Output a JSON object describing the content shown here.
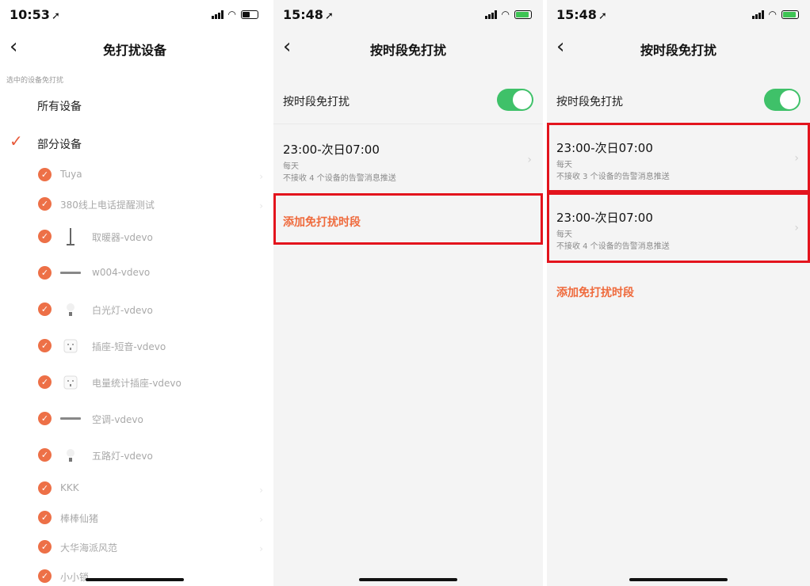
{
  "screen1": {
    "status_time": "10:53",
    "title": "免打扰设备",
    "section_hint": "选中的设备免打扰",
    "option_all": "所有设备",
    "option_partial": "部分设备",
    "devices": [
      {
        "name": "Tuya",
        "thumb": ""
      },
      {
        "name": "380线上电话提醒测试",
        "thumb": ""
      },
      {
        "name": "取暖器-vdevo",
        "thumb": "heater-icon"
      },
      {
        "name": "w004-vdevo",
        "thumb": "bar-icon"
      },
      {
        "name": "白光灯-vdevo",
        "thumb": "bulb-icon"
      },
      {
        "name": "插座-短音-vdevo",
        "thumb": "socket-icon"
      },
      {
        "name": "电量统计插座-vdevo",
        "thumb": "socket-icon"
      },
      {
        "name": "空调-vdevo",
        "thumb": "bar-icon"
      },
      {
        "name": "五路灯-vdevo",
        "thumb": "bulb-icon"
      },
      {
        "name": "KKK",
        "thumb": ""
      },
      {
        "name": "棒棒仙猪",
        "thumb": ""
      },
      {
        "name": "大华海派风范",
        "thumb": ""
      },
      {
        "name": "小小锁",
        "thumb": ""
      }
    ]
  },
  "screen2": {
    "status_time": "15:48",
    "title": "按时段免打扰",
    "toggle_label": "按时段免打扰",
    "periods": [
      {
        "time": "23:00-次日07:00",
        "repeat": "每天",
        "desc": "不接收 4 个设备的告警消息推送"
      }
    ],
    "add_label": "添加免打扰时段"
  },
  "screen3": {
    "status_time": "15:48",
    "title": "按时段免打扰",
    "toggle_label": "按时段免打扰",
    "periods": [
      {
        "time": "23:00-次日07:00",
        "repeat": "每天",
        "desc": "不接收 3 个设备的告警消息推送"
      },
      {
        "time": "23:00-次日07:00",
        "repeat": "每天",
        "desc": "不接收 4 个设备的告警消息推送"
      }
    ],
    "add_label": "添加免打扰时段"
  },
  "colors": {
    "accent": "#ef6a3c",
    "toggle_on": "#3fc169",
    "highlight": "#e3141d"
  }
}
